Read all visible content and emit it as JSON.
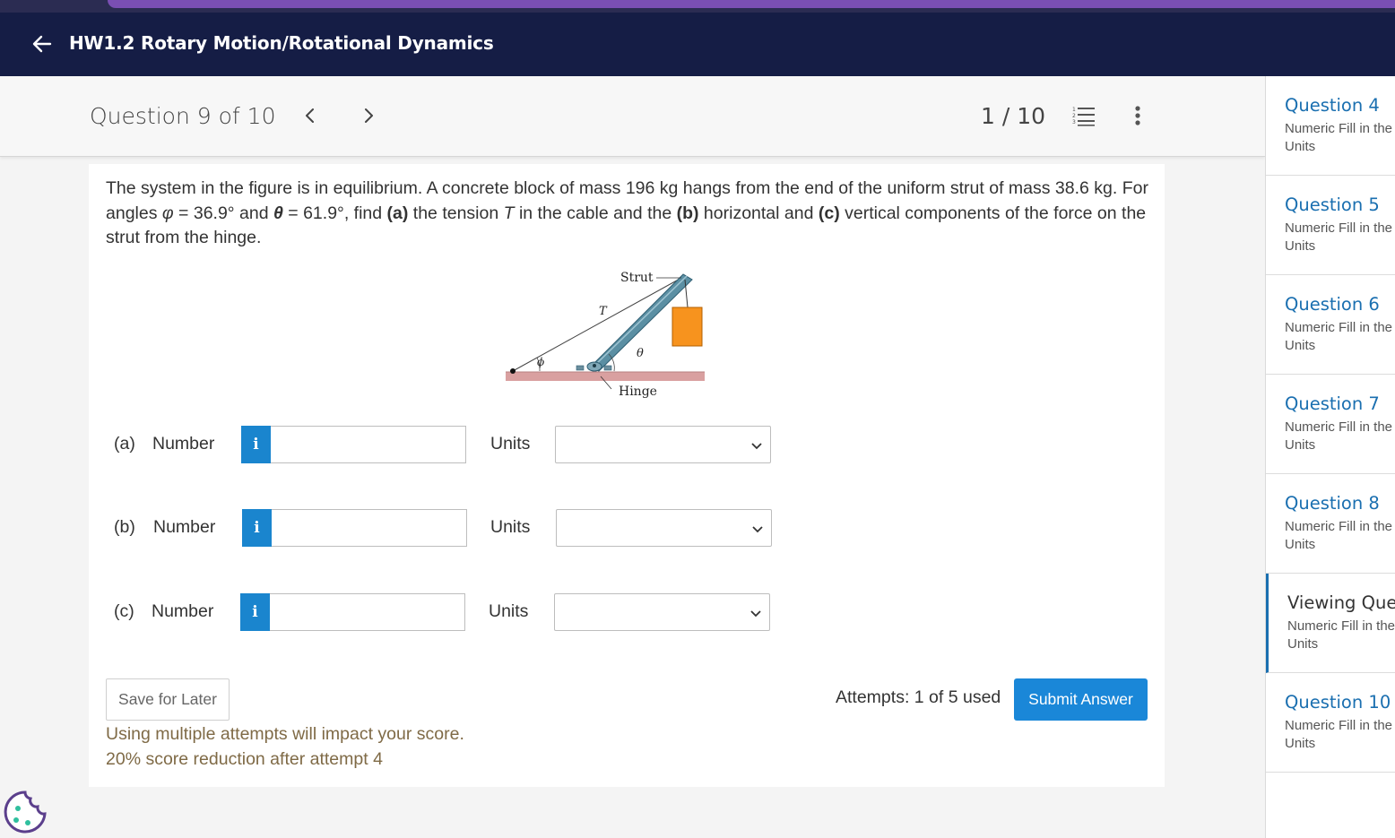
{
  "header": {
    "title": "HW1.2 Rotary Motion/Rotational Dynamics"
  },
  "question_nav": {
    "position_label": "Question 9 of 10",
    "page_count": "1 / 10"
  },
  "problem": {
    "text_1": "The system in the figure is in equilibrium. A concrete block of mass 196 kg hangs from the end of the uniform strut of mass 38.6 kg. For angles ",
    "phi_symbol": "φ",
    "text_2": " = 36.9° and ",
    "theta_symbol": "θ",
    "text_3": " = 61.9°, find ",
    "part_a": "(a)",
    "text_4": " the tension ",
    "t_symbol": "T",
    "text_5": " in the cable and the ",
    "part_b": "(b)",
    "text_6": " horizontal and ",
    "part_c": "(c)",
    "text_7": " vertical components of the force on the strut from the hinge."
  },
  "figure": {
    "strut_label": "Strut",
    "t_label": "T",
    "phi_label": "ϕ",
    "theta_label": "θ",
    "hinge_label": "Hinge",
    "colors": {
      "block": "#f7931e",
      "strut": "#5b8fa3",
      "ground": "#d9a0a0"
    }
  },
  "answers": [
    {
      "part": "(a)",
      "number_label": "Number",
      "info_label": "i",
      "value": "",
      "units_label": "Units",
      "units_value": ""
    },
    {
      "part": "(b)",
      "number_label": "Number",
      "info_label": "i",
      "value": "",
      "units_label": "Units",
      "units_value": ""
    },
    {
      "part": "(c)",
      "number_label": "Number",
      "info_label": "i",
      "value": "",
      "units_label": "Units",
      "units_value": ""
    }
  ],
  "footer": {
    "save_label": "Save for Later",
    "note_line1": "Using multiple attempts will impact your score.",
    "note_line2": "20% score reduction after attempt 4",
    "attempts": "Attempts: 1 of 5 used",
    "submit_label": "Submit Answer"
  },
  "sidebar": {
    "items": [
      {
        "title": "Question 4",
        "sub1": "Numeric Fill in the",
        "sub2": "Units"
      },
      {
        "title": "Question 5",
        "sub1": "Numeric Fill in the",
        "sub2": "Units"
      },
      {
        "title": "Question 6",
        "sub1": "Numeric Fill in the",
        "sub2": "Units"
      },
      {
        "title": "Question 7",
        "sub1": "Numeric Fill in the",
        "sub2": "Units"
      },
      {
        "title": "Question 8",
        "sub1": "Numeric Fill in the",
        "sub2": "Units"
      },
      {
        "title": "Viewing Que",
        "sub1": "Numeric Fill in the",
        "sub2": "Units"
      },
      {
        "title": "Question 10",
        "sub1": "Numeric Fill in the",
        "sub2": "Units"
      }
    ]
  },
  "colors": {
    "topbar": "#151d45",
    "accent": "#1a87d8",
    "link": "#1a6fb0"
  }
}
